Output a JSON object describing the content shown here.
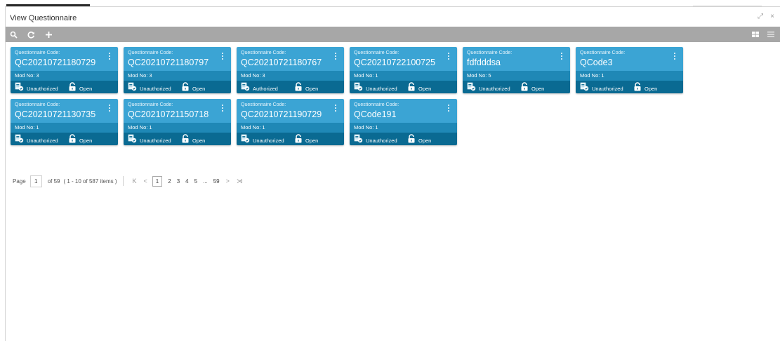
{
  "window": {
    "title": "View Questionnaire",
    "controls": [
      {
        "icon": "expand-icon",
        "glyph": "⤢"
      },
      {
        "icon": "close-icon",
        "glyph": "×"
      }
    ]
  },
  "toolbar": {
    "left_icons": [
      "search-icon",
      "refresh-icon",
      "add-icon"
    ],
    "right_icons": [
      "grid-view-icon",
      "list-view-icon"
    ],
    "color": "#a7a7a7"
  },
  "card_label": "Questionnaire Code:",
  "cards": [
    {
      "code": "QC20210721180729",
      "mod": "Mod No: 3",
      "status": "Unauthorized",
      "lock": "Open"
    },
    {
      "code": "QC20210721180797",
      "mod": "Mod No: 3",
      "status": "Unauthorized",
      "lock": "Open"
    },
    {
      "code": "QC20210721180767",
      "mod": "Mod No: 3",
      "status": "Authorized",
      "lock": "Open"
    },
    {
      "code": "QC20210722100725",
      "mod": "Mod No: 1",
      "status": "Unauthorized",
      "lock": "Open"
    },
    {
      "code": "fdfdddsa",
      "mod": "Mod No: 5",
      "status": "Unauthorized",
      "lock": "Open"
    },
    {
      "code": "QCode3",
      "mod": "Mod No: 1",
      "status": "Unauthorized",
      "lock": "Open"
    },
    {
      "code": "QC20210721130735",
      "mod": "Mod No: 1",
      "status": "Unauthorized",
      "lock": "Open"
    },
    {
      "code": "QC20210721150718",
      "mod": "Mod No: 1",
      "status": "Unauthorized",
      "lock": "Open"
    },
    {
      "code": "QC20210721190729",
      "mod": "Mod No: 1",
      "status": "Unauthorized",
      "lock": "Open"
    },
    {
      "code": "QCode191",
      "mod": "Mod No: 1",
      "status": "Unauthorized",
      "lock": "Open"
    }
  ],
  "colors": {
    "card_top": "#3ba4d4",
    "card_mod": "#1f88b6",
    "card_foot": "#0a6a92"
  },
  "pager": {
    "page_label": "Page",
    "current": "1",
    "of_text": "of 59",
    "items_text": "( 1 - 10 of 587 items )",
    "first": "K",
    "prev": "<",
    "pages": [
      "1",
      "2",
      "3",
      "4",
      "5",
      "...",
      "59"
    ],
    "next": ">",
    "last": "⋊"
  }
}
